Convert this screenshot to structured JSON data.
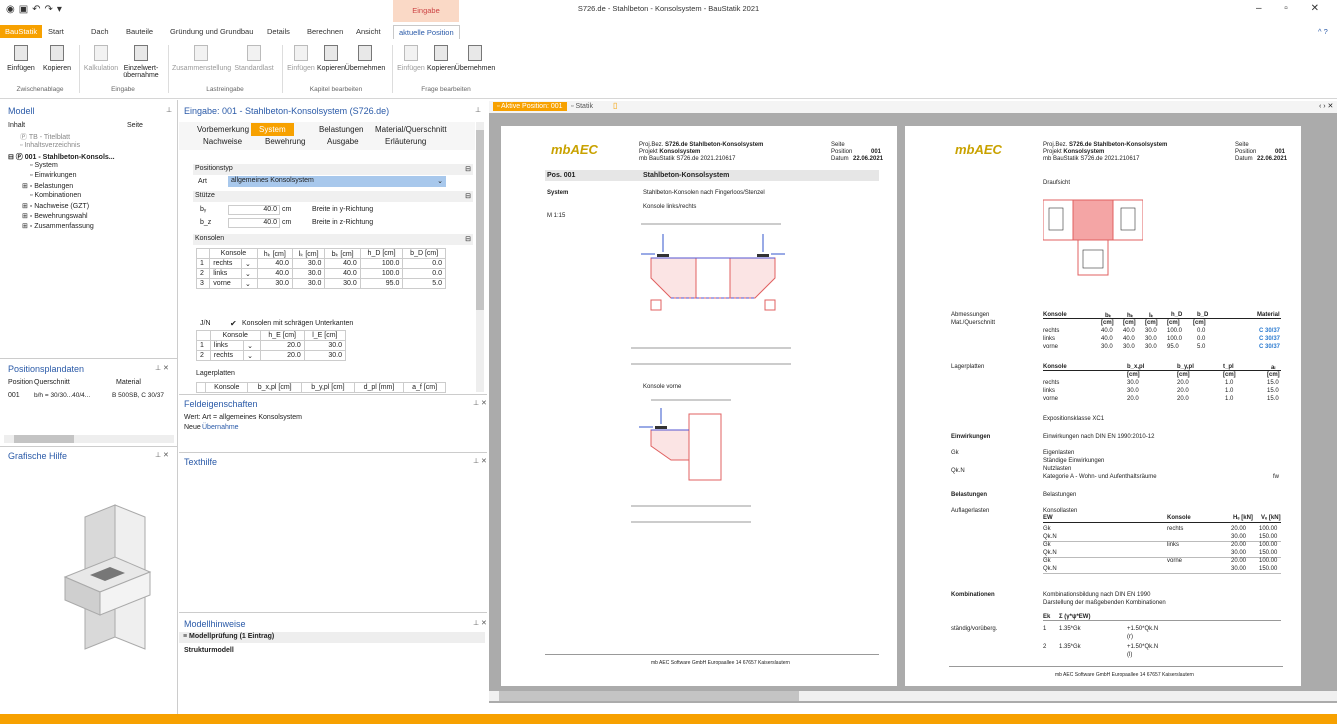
{
  "window": {
    "title": "S726.de - Stahlbeton - Konsolsystem - BauStatik 2021",
    "context_tab": "Eingabe",
    "controls": "– ▫ ✕"
  },
  "tabs": [
    "BauStatik",
    "Start",
    "Dach",
    "Bauteile",
    "Gründung und Grundbau",
    "Details",
    "Berechnen",
    "Ansicht",
    "aktuelle Position"
  ],
  "ribbon": {
    "buttons": [
      "Einfügen",
      "Kopieren",
      "Kalkulation",
      "Einzelwert-übernahme",
      "Zusammenstellung",
      "Standardlast",
      "Einfügen",
      "Kopieren",
      "Übernehmen",
      "Einfügen",
      "Kopieren",
      "Übernehmen"
    ],
    "groups": [
      "Zwischenablage",
      "Eingabe",
      "Lastreingabe",
      "Kapitel bearbeiten",
      "Frage bearbeiten"
    ]
  },
  "modell": {
    "title": "Modell",
    "col_inhalt": "Inhalt",
    "col_seite": "Seite",
    "tree": [
      "TB - Titelblatt",
      "Inhaltsverzeichnis",
      "001 - Stahlbeton-Konsols...",
      "System",
      "Einwirkungen",
      "Belastungen",
      "Kombinationen",
      "Nachweise (GZT)",
      "Bewehrungswahl",
      "Zusammenfassung"
    ]
  },
  "positionsplan": {
    "title": "Positionsplandaten",
    "headers": [
      "Position",
      "Querschnitt",
      "Material"
    ],
    "row": [
      "001",
      "b/h = 30/30...40/4...",
      "B 500SB, C 30/37"
    ]
  },
  "grafik": {
    "title": "Grafische Hilfe"
  },
  "eingabe": {
    "title": "Eingabe: 001 - Stahlbeton-Konsolsystem (S726.de)",
    "tabs": [
      "Vorbemerkung",
      "System",
      "Belastungen",
      "Material/Querschnitt",
      "Nachweise",
      "Bewehrung",
      "Ausgabe",
      "Erläuterung"
    ],
    "positionstyp": "Positionstyp",
    "art_label": "Art",
    "art_value": "allgemeines Konsolsystem",
    "stuetze": "Stütze",
    "by_label": "bᵧ",
    "by_val": "40.0",
    "by_unit": "cm",
    "by_desc": "Breite in y-Richtung",
    "bz_label": "b_z",
    "bz_val": "40.0",
    "bz_unit": "cm",
    "bz_desc": "Breite in z-Richtung",
    "konsolen": "Konsolen",
    "k_headers": [
      "Konsole",
      "hₖ [cm]",
      "lₖ [cm]",
      "bₖ [cm]",
      "h_D [cm]",
      "b_D [cm]"
    ],
    "k_rows": [
      [
        "1",
        "rechts",
        "40.0",
        "30.0",
        "40.0",
        "100.0",
        "0.0"
      ],
      [
        "2",
        "links",
        "40.0",
        "30.0",
        "40.0",
        "100.0",
        "0.0"
      ],
      [
        "3",
        "vorne",
        "30.0",
        "30.0",
        "30.0",
        "95.0",
        "5.0"
      ]
    ],
    "jn": "J/N",
    "schraeg": "Konsolen mit schrägen Unterkanten",
    "s_headers": [
      "Konsole",
      "h_E [cm]",
      "l_E [cm]"
    ],
    "s_rows": [
      [
        "1",
        "links",
        "20.0",
        "30.0"
      ],
      [
        "2",
        "rechts",
        "20.0",
        "30.0"
      ]
    ],
    "lager": "Lagerplatten",
    "lager_headers": [
      "Konsole",
      "b_x,pl [cm]",
      "b_y,pl [cm]",
      "d_pl [mm]",
      "a_f [cm]"
    ]
  },
  "feld": {
    "title": "Feldeigenschaften",
    "wert": "Wert: Art = allgemeines Konsolsystem",
    "neue": "Neue",
    "uebernahme": "Übernahme"
  },
  "texthilfe": {
    "title": "Texthilfe"
  },
  "modellhinweise": {
    "title": "Modellhinweise",
    "pruefung": "Modellprüfung (1 Eintrag)",
    "struktur": "Strukturmodell"
  },
  "doc_tabs": [
    "Aktive Position: 001",
    "Statik"
  ],
  "page1": {
    "proj_bez": "Proj.Bez.",
    "proj_bez_val": "S726.de Stahlbeton-Konsolsystem",
    "projekt": "Projekt",
    "projekt_val": "Konsolsystem",
    "file": "mb BauStatik S726.de  2021.210617",
    "seite": "Seite",
    "position": "Position",
    "position_val": "001",
    "datum": "Datum",
    "datum_val": "22.06.2021",
    "pos": "Pos. 001",
    "pos_title": "Stahlbeton-Konsolsystem",
    "system": "System",
    "system_text": "Stahlbeton-Konsolen nach Fingerloos/Stenzel",
    "mass": "M 1:15",
    "konsole1": "Konsole links/rechts",
    "konsole2": "Konsole vorne",
    "footer": "mb AEC Software GmbH  Europaallee 14  67657 Kaiserslautern"
  },
  "page2": {
    "draufsicht": "Draufsicht",
    "abm": "Abmessungen",
    "matq": "Mat./Querschnitt",
    "abm_headers": [
      "Konsole",
      "bₖ",
      "hₖ",
      "lₖ",
      "h_D",
      "b_D",
      "Material"
    ],
    "abm_units": [
      "",
      "[cm]",
      "[cm]",
      "[cm]",
      "[cm]",
      "[cm]",
      ""
    ],
    "abm_rows": [
      [
        "rechts",
        "40.0",
        "40.0",
        "30.0",
        "100.0",
        "0.0",
        "C 30/37"
      ],
      [
        "links",
        "40.0",
        "40.0",
        "30.0",
        "100.0",
        "0.0",
        "C 30/37"
      ],
      [
        "vorne",
        "30.0",
        "30.0",
        "30.0",
        "95.0",
        "5.0",
        "C 30/37"
      ]
    ],
    "lagerplatten": "Lagerplatten",
    "lp_headers": [
      "Konsole",
      "b_x,pl",
      "b_y,pl",
      "t_pl",
      "aₗ"
    ],
    "lp_units": [
      "",
      "[cm]",
      "[cm]",
      "[cm]",
      "[cm]"
    ],
    "lp_rows": [
      [
        "rechts",
        "30.0",
        "20.0",
        "1.0",
        "15.0"
      ],
      [
        "links",
        "30.0",
        "20.0",
        "1.0",
        "15.0"
      ],
      [
        "vorne",
        "20.0",
        "20.0",
        "1.0",
        "15.0"
      ]
    ],
    "expo": "Expositionsklasse XC1",
    "einw": "Einwirkungen",
    "einw_text": "Einwirkungen nach DIN EN 1990:2010-12",
    "gk": "Gk",
    "gk_t1": "Eigenlasten",
    "gk_t2": "Ständige Einwirkungen",
    "qkn": "Qk.N",
    "qkn_t1": "Nutzlasten",
    "qkn_t2": "Kategorie A - Wohn- und Aufenthaltsräume",
    "fw": "fw",
    "belast": "Belastungen",
    "belast_text": "Belastungen",
    "auflager": "Auflagerlasten",
    "konsollasten": "Konsollasten",
    "bl_headers": [
      "EW",
      "Konsole",
      "Hₑ [kN]",
      "Vₑ [kN]"
    ],
    "bl_rows": [
      [
        "Gk",
        "rechts",
        "20.00",
        "100.00"
      ],
      [
        "Qk.N",
        "",
        "30.00",
        "150.00"
      ],
      [
        "Gk",
        "links",
        "20.00",
        "100.00"
      ],
      [
        "Qk.N",
        "",
        "30.00",
        "150.00"
      ],
      [
        "Gk",
        "vorne",
        "20.00",
        "100.00"
      ],
      [
        "Qk.N",
        "",
        "30.00",
        "150.00"
      ]
    ],
    "komb": "Kombinationen",
    "komb_t1": "Kombinationsbildung nach DIN EN 1990",
    "komb_t2": "Darstellung der maßgebenden Kombinationen",
    "staendig": "ständig/vorüberg.",
    "ek": "Ek",
    "sum": "Σ (γ*ψ*EW)",
    "ek1": "1",
    "ek1_v": "1.35*Gk",
    "ek1_w": "+1.50*Qk.N",
    "ek1_r": "(r)",
    "ek2": "2",
    "ek2_v": "1.35*Gk",
    "ek2_w": "+1.50*Qk.N",
    "ek2_r": "(l)",
    "footer": "mb AEC Software GmbH  Europaallee 14  67657 Kaiserslautern"
  },
  "logo": "mbAEC"
}
